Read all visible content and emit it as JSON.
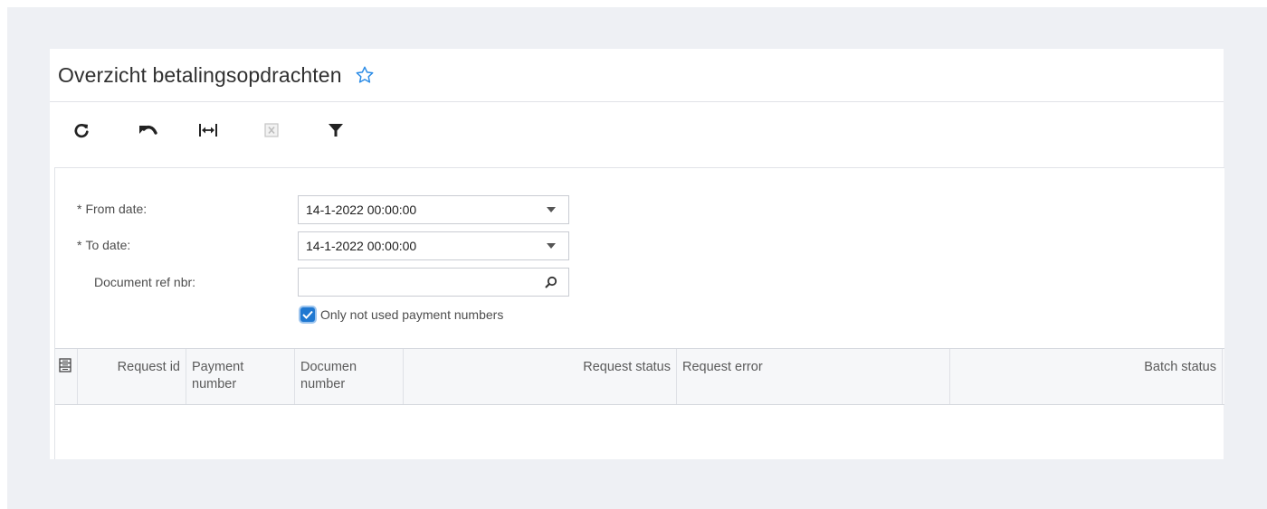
{
  "page": {
    "title": "Overzicht betalingsopdrachten",
    "favorite_icon": "star-outline-icon"
  },
  "toolbar": {
    "buttons": [
      {
        "name": "refresh",
        "icon": "refresh-icon"
      },
      {
        "name": "undo",
        "icon": "undo-icon"
      },
      {
        "name": "fit-columns",
        "icon": "fit-width-icon"
      },
      {
        "name": "export-excel",
        "icon": "excel-icon"
      },
      {
        "name": "filter",
        "icon": "filter-icon"
      }
    ]
  },
  "filters": {
    "from_date": {
      "label": "From date:",
      "required": "*",
      "value": "14-1-2022 00:00:00"
    },
    "to_date": {
      "label": "To date:",
      "required": "*",
      "value": "14-1-2022 00:00:00"
    },
    "document_ref": {
      "label": "Document ref nbr:",
      "value": ""
    },
    "only_not_used": {
      "label": "Only not used payment numbers",
      "checked": true
    }
  },
  "grid": {
    "columns": [
      {
        "label": "Request id"
      },
      {
        "label": "Payment number"
      },
      {
        "label": "Documen number"
      },
      {
        "label": "Request status"
      },
      {
        "label": "Request error"
      },
      {
        "label": "Batch status"
      }
    ],
    "rows": []
  },
  "colors": {
    "accent": "#1f78d1",
    "star": "#2a8be6",
    "background": "#eef0f4"
  }
}
